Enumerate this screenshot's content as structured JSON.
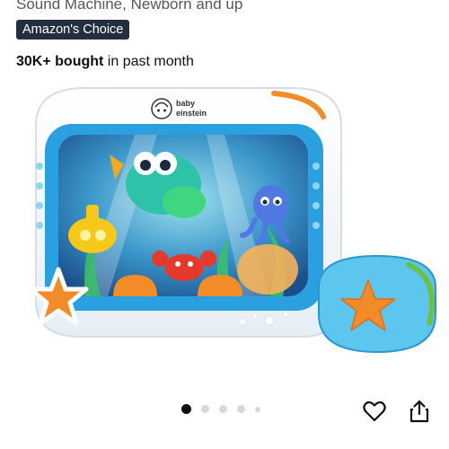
{
  "header": {
    "subtitle": "Sound Machine, Newborn and up",
    "badge": "Amazon's Choice",
    "bought_bold": "30K+ bought",
    "bought_rest": " in past month"
  },
  "product": {
    "brand_line1": "baby",
    "brand_line2": "einstein"
  },
  "gallery": {
    "image_count": 5,
    "active_index": 1
  },
  "actions": {
    "wishlist_icon": "heart-icon",
    "share_icon": "share-icon"
  }
}
